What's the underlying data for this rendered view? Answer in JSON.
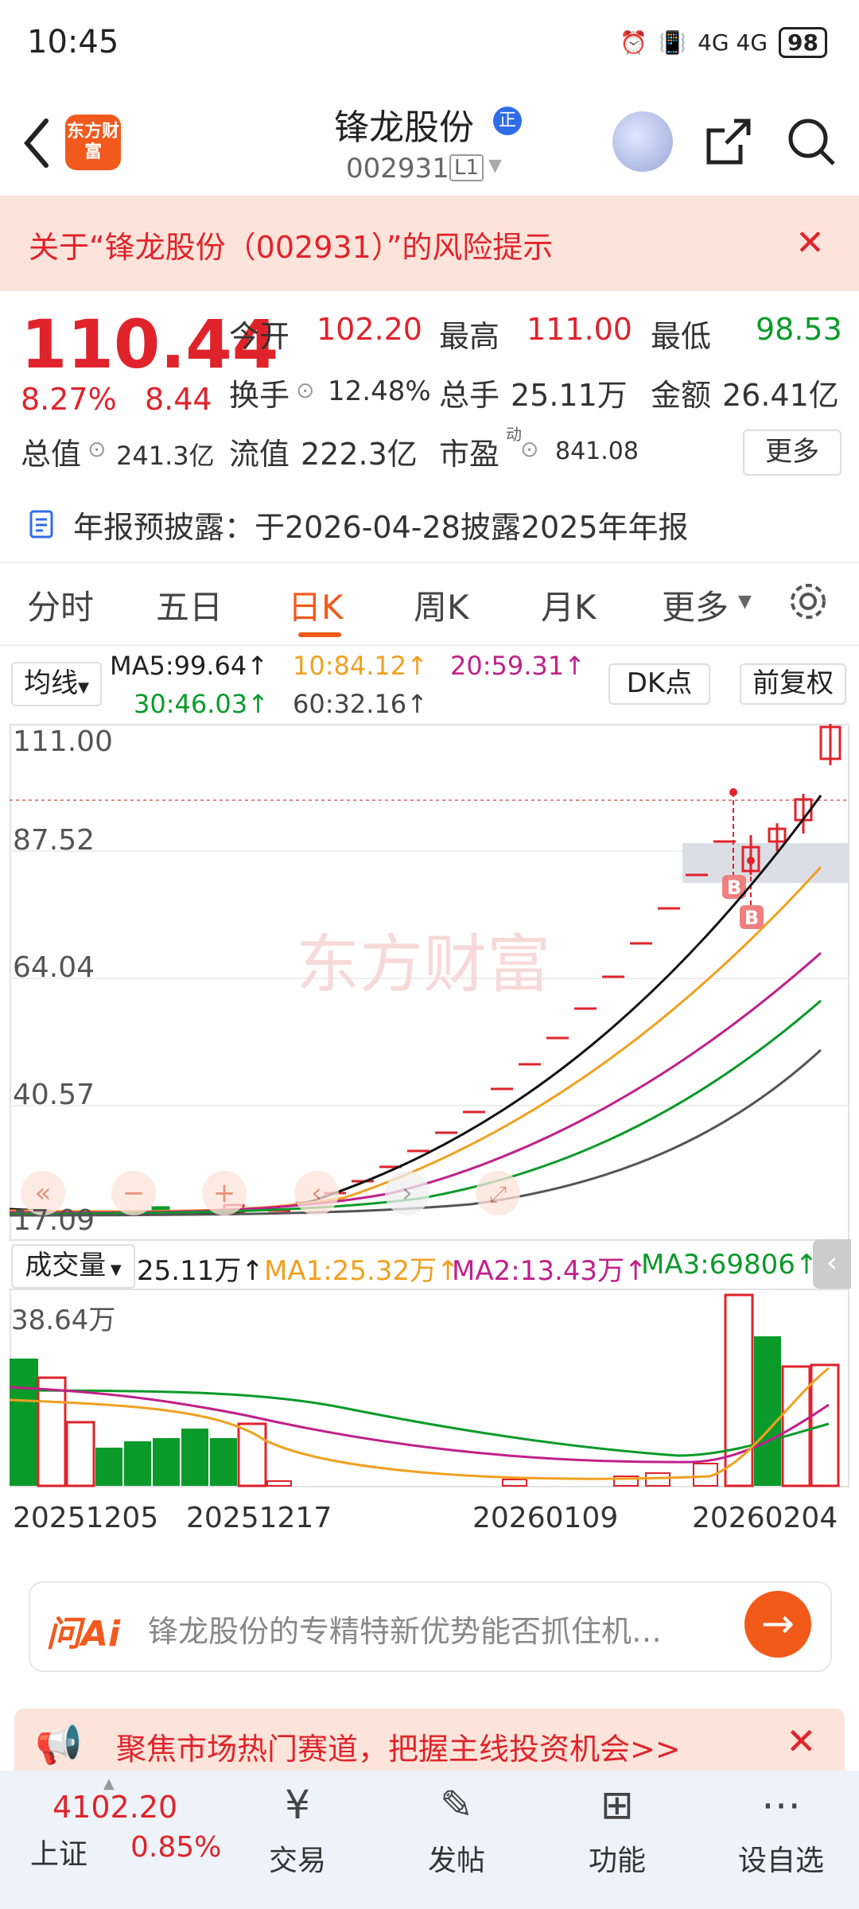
{
  "status_bar": {
    "time": "10:45",
    "network": "4G 4G",
    "battery": "98"
  },
  "header": {
    "back_icon": "chevron-left-icon",
    "logo_text": "东方财富",
    "stock_name": "锋龙股份",
    "badge": "正",
    "code": "002931",
    "level": "L1"
  },
  "risk_banner": {
    "text": "关于“锋龙股份（002931）”的风险提示",
    "close": "✕"
  },
  "quote": {
    "price": "110.44",
    "change_pct": "8.27%",
    "change": "8.44",
    "open_label": "今开",
    "open": "102.20",
    "high_label": "最高",
    "high": "111.00",
    "low_label": "最低",
    "low": "98.53",
    "turnover_label": "换手",
    "turnover": "12.48%",
    "volume_label": "总手",
    "volume": "25.11万",
    "amount_label": "金额",
    "amount": "26.41亿",
    "mv_label": "总值",
    "mv": "241.3亿",
    "float_label": "流值",
    "float": "222.3亿",
    "pe_label": "市盈",
    "pe_sup": "动",
    "pe": "841.08",
    "more": "更多"
  },
  "annual_notice": "年报预披露：于2026-04-28披露2025年年报",
  "tabs": [
    "分时",
    "五日",
    "日K",
    "周K",
    "月K",
    "更多"
  ],
  "ma": {
    "selector": "均线",
    "ma5": "MA5:99.64↑",
    "ma10": "10:84.12↑",
    "ma20": "20:59.31↑",
    "ma30": "30:46.03↑",
    "ma60": "60:32.16↑",
    "dk": "DK点",
    "fuquan": "前复权"
  },
  "chart": {
    "y_labels": [
      "111.00",
      "87.52",
      "64.04",
      "40.57",
      "17.09"
    ],
    "buy_marker": "B",
    "watermark": "东方财富"
  },
  "volume": {
    "selector": "成交量",
    "current": "25.11万↑",
    "ma1": "MA1:25.32万↑",
    "ma2": "MA2:13.43万↑",
    "ma3": "MA3:69806↑",
    "max": "38.64万",
    "dates": [
      "20251205",
      "20251217",
      "20260109",
      "20260204"
    ]
  },
  "ai": {
    "logo": "问Ai",
    "text": "锋龙股份的专精特新优势能否抓住机…"
  },
  "promo": {
    "text": "聚焦市场热门赛道，把握主线投资机会>>"
  },
  "bottom": {
    "index_value": "4102.20",
    "index_name": "上证",
    "index_pct": "0.85%",
    "nav": [
      "交易",
      "发帖",
      "功能",
      "设自选"
    ]
  },
  "colors": {
    "up": "#e0232b",
    "down": "#0a9a2a",
    "accent": "#f25a1a"
  }
}
